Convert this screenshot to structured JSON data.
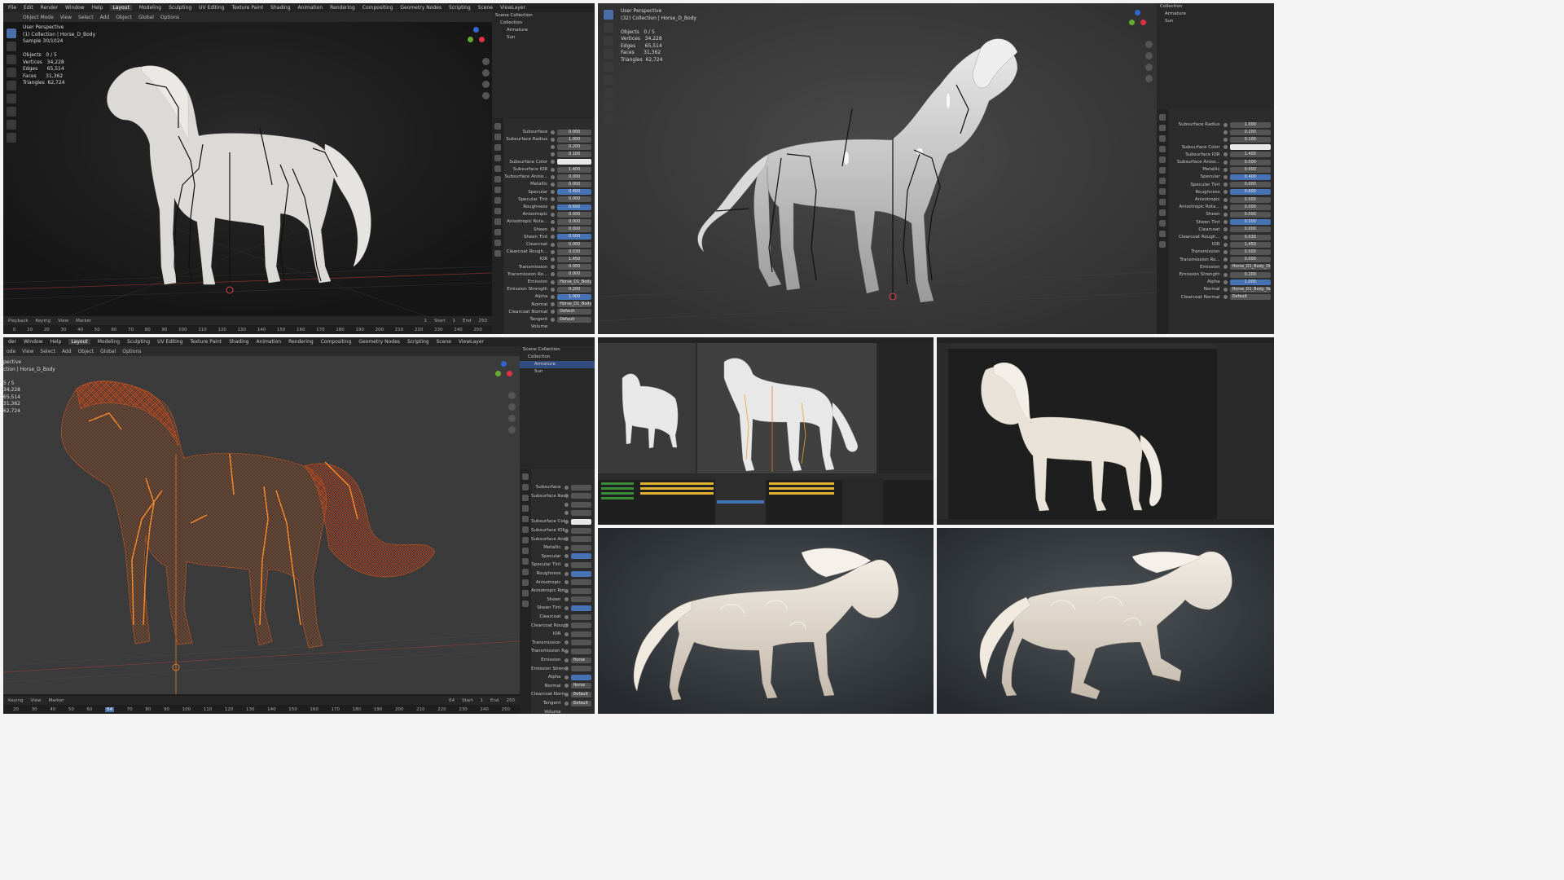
{
  "colors": {
    "accent": "#4772b3",
    "viewport_bg": "#2a2a2a",
    "wireframe": "#e0581c",
    "bone": "#111111",
    "horse_body": "#dcdad6"
  },
  "tile1": {
    "menu": [
      "File",
      "Edit",
      "Render",
      "Window",
      "Help",
      "Layout",
      "Modeling",
      "Sculpting",
      "UV Editing",
      "Texture Paint",
      "Shading",
      "Animation",
      "Rendering",
      "Compositing",
      "Geometry Nodes",
      "Scripting",
      "Scene",
      "ViewLayer"
    ],
    "active_tab": "Layout",
    "header2": [
      "Object Mode",
      "View",
      "Select",
      "Add",
      "Object",
      "Global",
      "Options"
    ],
    "stats": "User Perspective\n(1) Collection | Horse_D_Body\nSample 30/1024\n\nObjects   0 / 5\nVertices   34,228\nEdges      65,514\nFaces      31,362\nTriangles  62,724",
    "outliner": [
      "Scene Collection",
      "Collection",
      "Armature",
      "Sun"
    ],
    "timeline_menu": [
      "Playback",
      "Keying",
      "View",
      "Marker"
    ],
    "timeline_fields": [
      "1",
      "Start",
      "1",
      "End",
      "250"
    ],
    "timeline_ticks": [
      "0",
      "10",
      "20",
      "30",
      "40",
      "50",
      "60",
      "70",
      "80",
      "90",
      "100",
      "110",
      "120",
      "130",
      "140",
      "150",
      "160",
      "170",
      "180",
      "190",
      "200",
      "210",
      "220",
      "230",
      "240",
      "250"
    ],
    "props": [
      {
        "label": "Subsurface",
        "value": "0.000",
        "kind": ""
      },
      {
        "label": "Subsurface Radius",
        "value": "1.000",
        "kind": ""
      },
      {
        "label": "",
        "value": "0.200",
        "kind": ""
      },
      {
        "label": "",
        "value": "0.100",
        "kind": ""
      },
      {
        "label": "Subsurface Color",
        "value": "",
        "kind": "white"
      },
      {
        "label": "Subsurface IOR",
        "value": "1.400",
        "kind": ""
      },
      {
        "label": "Subsurface Aniso...",
        "value": "0.000",
        "kind": ""
      },
      {
        "label": "Metallic",
        "value": "0.000",
        "kind": ""
      },
      {
        "label": "Specular",
        "value": "0.400",
        "kind": "blue"
      },
      {
        "label": "Specular Tint",
        "value": "0.000",
        "kind": ""
      },
      {
        "label": "Roughness",
        "value": "0.600",
        "kind": "blue"
      },
      {
        "label": "Anisotropic",
        "value": "0.000",
        "kind": ""
      },
      {
        "label": "Anisotropic Rota...",
        "value": "0.000",
        "kind": ""
      },
      {
        "label": "Sheen",
        "value": "0.000",
        "kind": ""
      },
      {
        "label": "Sheen Tint",
        "value": "0.500",
        "kind": "blue"
      },
      {
        "label": "Clearcoat",
        "value": "0.000",
        "kind": ""
      },
      {
        "label": "Clearcoat Rough...",
        "value": "0.030",
        "kind": ""
      },
      {
        "label": "IOR",
        "value": "1.450",
        "kind": ""
      },
      {
        "label": "Transmission",
        "value": "0.000",
        "kind": ""
      },
      {
        "label": "Transmission Ro...",
        "value": "0.000",
        "kind": ""
      },
      {
        "label": "Emission",
        "value": "Horse_D1_Body_Diffuse",
        "kind": "text"
      },
      {
        "label": "Emission Strength",
        "value": "0.200",
        "kind": ""
      },
      {
        "label": "Alpha",
        "value": "1.000",
        "kind": "blue"
      },
      {
        "label": "Normal",
        "value": "Horse_D1_Body_Normal",
        "kind": "text"
      },
      {
        "label": "Clearcoat Normal",
        "value": "Default",
        "kind": "text"
      },
      {
        "label": "Tangent",
        "value": "Default",
        "kind": "text"
      },
      {
        "label": "Volume",
        "value": "",
        "kind": "none"
      }
    ]
  },
  "tile2": {
    "stats": "User Perspective\n(32) Collection | Horse_D_Body\n\nObjects   0 / 5\nVertices   34,228\nEdges      65,514\nFaces      31,362\nTriangles  62,724",
    "outliner": [
      "Collection",
      "Armature",
      "Sun"
    ],
    "props": [
      {
        "label": "Subsurface Radius",
        "value": "1.000",
        "kind": ""
      },
      {
        "label": "",
        "value": "0.200",
        "kind": ""
      },
      {
        "label": "",
        "value": "0.100",
        "kind": ""
      },
      {
        "label": "Subsurface Color",
        "value": "",
        "kind": "white"
      },
      {
        "label": "Subsurface IOR",
        "value": "1.400",
        "kind": ""
      },
      {
        "label": "Subsurface Aniso...",
        "value": "0.000",
        "kind": ""
      },
      {
        "label": "Metallic",
        "value": "0.000",
        "kind": ""
      },
      {
        "label": "Specular",
        "value": "0.400",
        "kind": "blue"
      },
      {
        "label": "Specular Tint",
        "value": "0.000",
        "kind": ""
      },
      {
        "label": "Roughness",
        "value": "0.600",
        "kind": "blue"
      },
      {
        "label": "Anisotropic",
        "value": "0.000",
        "kind": ""
      },
      {
        "label": "Anisotropic Rota...",
        "value": "0.000",
        "kind": ""
      },
      {
        "label": "Sheen",
        "value": "0.000",
        "kind": ""
      },
      {
        "label": "Sheen Tint",
        "value": "0.500",
        "kind": "blue"
      },
      {
        "label": "Clearcoat",
        "value": "0.000",
        "kind": ""
      },
      {
        "label": "Clearcoat Rough...",
        "value": "0.030",
        "kind": ""
      },
      {
        "label": "IOR",
        "value": "1.450",
        "kind": ""
      },
      {
        "label": "Transmission",
        "value": "0.000",
        "kind": ""
      },
      {
        "label": "Transmission Ro...",
        "value": "0.000",
        "kind": ""
      },
      {
        "label": "Emission",
        "value": "Horse_D1_Body_Diffuse",
        "kind": "text"
      },
      {
        "label": "Emission Strength",
        "value": "0.200",
        "kind": ""
      },
      {
        "label": "Alpha",
        "value": "1.000",
        "kind": "blue"
      },
      {
        "label": "Normal",
        "value": "Horse_D1_Body_Normal",
        "kind": "text"
      },
      {
        "label": "Clearcoat Normal",
        "value": "Default",
        "kind": "text"
      }
    ]
  },
  "tile3": {
    "menu": [
      "der",
      "Window",
      "Help",
      "Layout",
      "Modeling",
      "Sculpting",
      "UV Editing",
      "Texture Paint",
      "Shading",
      "Animation",
      "Rendering",
      "Compositing",
      "Geometry Nodes",
      "Scripting",
      "Scene",
      "ViewLayer"
    ],
    "active_tab": "Layout",
    "header2": [
      "ode",
      "View",
      "Select",
      "Add",
      "Object",
      "Global",
      "Options"
    ],
    "stats": "pective\nction | Horse_D_Body\n\n5 / 5\n34,228\n65,514\n31,362\n62,724",
    "outliner": [
      "Scene Collection",
      "Collection",
      "Armature",
      "Sun"
    ],
    "timeline_menu": [
      "Keying",
      "View",
      "Marker"
    ],
    "timeline_fields": [
      "64",
      "Start",
      "1",
      "End",
      "250"
    ],
    "timeline_ticks": [
      "20",
      "30",
      "40",
      "50",
      "60",
      "64",
      "70",
      "80",
      "90",
      "100",
      "110",
      "120",
      "130",
      "140",
      "150",
      "160",
      "170",
      "180",
      "190",
      "200",
      "210",
      "220",
      "230",
      "240",
      "250"
    ],
    "playhead": "64",
    "props": [
      {
        "label": "Subsurface",
        "value": "",
        "kind": ""
      },
      {
        "label": "Subsurface Radius",
        "value": "",
        "kind": ""
      },
      {
        "label": "",
        "value": "",
        "kind": ""
      },
      {
        "label": "",
        "value": "",
        "kind": ""
      },
      {
        "label": "Subsurface Color",
        "value": "",
        "kind": "white"
      },
      {
        "label": "Subsurface IOR",
        "value": "",
        "kind": ""
      },
      {
        "label": "Subsurface Aniso...",
        "value": "",
        "kind": ""
      },
      {
        "label": "Metallic",
        "value": "",
        "kind": ""
      },
      {
        "label": "Specular",
        "value": "",
        "kind": "blue"
      },
      {
        "label": "Specular Tint",
        "value": "",
        "kind": ""
      },
      {
        "label": "Roughness",
        "value": "",
        "kind": "blue"
      },
      {
        "label": "Anisotropic",
        "value": "",
        "kind": ""
      },
      {
        "label": "Anisotropic Rota...",
        "value": "",
        "kind": ""
      },
      {
        "label": "Sheen",
        "value": "",
        "kind": ""
      },
      {
        "label": "Sheen Tint",
        "value": "",
        "kind": "blue"
      },
      {
        "label": "Clearcoat",
        "value": "",
        "kind": ""
      },
      {
        "label": "Clearcoat Rough...",
        "value": "",
        "kind": ""
      },
      {
        "label": "IOR",
        "value": "",
        "kind": ""
      },
      {
        "label": "Transmission",
        "value": "",
        "kind": ""
      },
      {
        "label": "Transmission Ro...",
        "value": "",
        "kind": ""
      },
      {
        "label": "Emission",
        "value": "Horse",
        "kind": "text"
      },
      {
        "label": "Emission Strength",
        "value": "",
        "kind": ""
      },
      {
        "label": "Alpha",
        "value": "",
        "kind": "blue"
      },
      {
        "label": "Normal",
        "value": "Horse",
        "kind": "text"
      },
      {
        "label": "Clearcoat Normal",
        "value": "Default",
        "kind": "text"
      },
      {
        "label": "Tangent",
        "value": "Default",
        "kind": "text"
      },
      {
        "label": "Volume",
        "value": "",
        "kind": "none"
      }
    ]
  }
}
